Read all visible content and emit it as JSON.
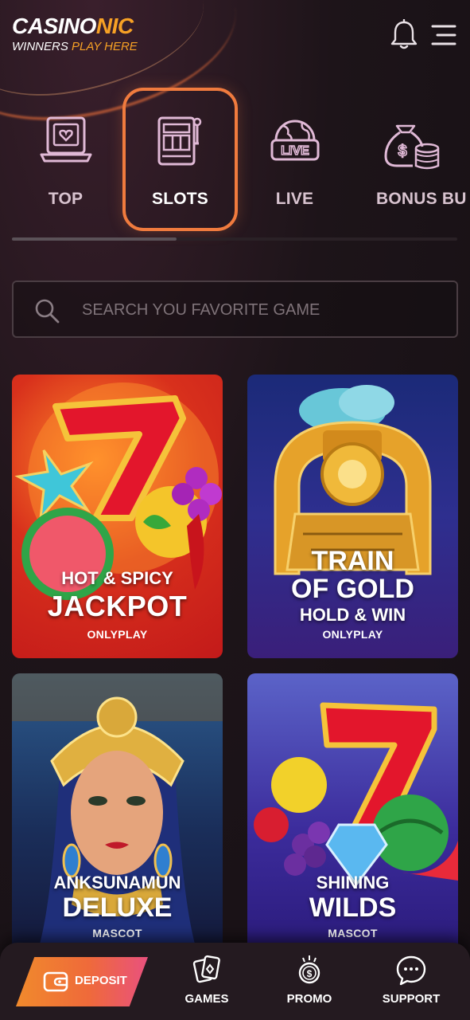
{
  "brand": {
    "logo_white": "CASINO",
    "logo_orange": "NIC",
    "tagline_white": "WINNERS ",
    "tagline_orange": "PLAY HERE"
  },
  "header_icons": [
    "bell-icon",
    "hamburger-menu-icon"
  ],
  "categories": [
    {
      "label": "TOP",
      "icon": "laptop-heart-icon",
      "active": false
    },
    {
      "label": "SLOTS",
      "icon": "slot-machine-icon",
      "active": true
    },
    {
      "label": "LIVE",
      "icon": "live-globe-icon",
      "active": false
    },
    {
      "label": "BONUS BU",
      "icon": "money-bag-icon",
      "active": false
    }
  ],
  "category_scroll_position": 0.37,
  "search": {
    "placeholder": "SEARCH YOU FAVORITE GAME",
    "value": ""
  },
  "games": [
    {
      "line1": "HOT & SPICY",
      "line2": "JACKPOT",
      "line3": "",
      "provider": "ONLYPLAY"
    },
    {
      "line1": "TRAIN",
      "line2": "OF GOLD",
      "line3": "HOLD & WIN",
      "provider": "ONLYPLAY"
    },
    {
      "line1": "ANKSUNAMUN",
      "line2": "DELUXE",
      "line3": "",
      "provider": "MASCOT"
    },
    {
      "line1": "SHINING",
      "line2": "WILDS",
      "line3": "",
      "provider": "MASCOT"
    }
  ],
  "bottom_nav": {
    "deposit": "DEPOSIT",
    "games": "GAMES",
    "promo": "PROMO",
    "support": "SUPPORT"
  },
  "colors": {
    "accent_orange": "#f7a125",
    "active_border": "#f07b3e",
    "background": "#1d1419"
  }
}
